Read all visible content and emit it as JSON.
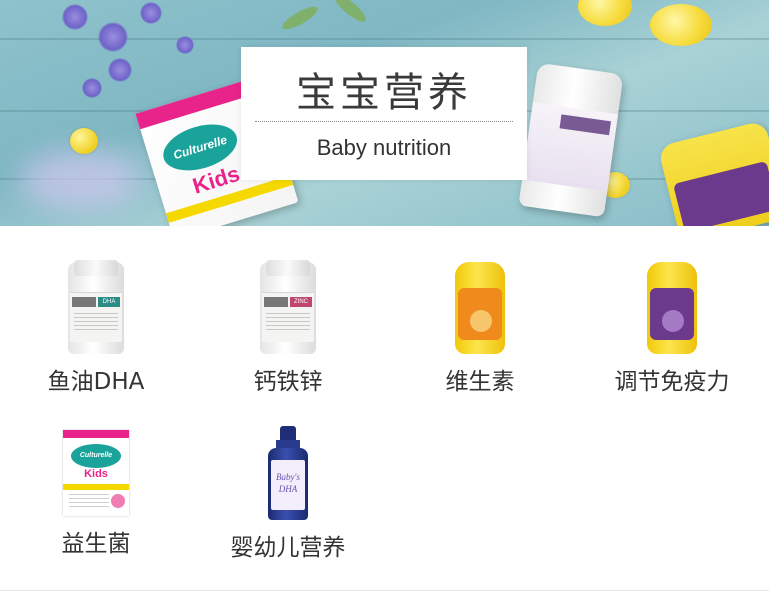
{
  "banner": {
    "title_cn": "宝宝营养",
    "title_en": "Baby nutrition"
  },
  "categories": [
    {
      "label": "鱼油DHA",
      "product": "bottle",
      "tag": "DHA",
      "tag_color": "#2c8c86"
    },
    {
      "label": "钙铁锌",
      "product": "bottle",
      "tag": "ZINC",
      "tag_color": "#c0466e"
    },
    {
      "label": "维生素",
      "product": "jar",
      "jar_label_color": "#f08a1c"
    },
    {
      "label": "调节免疫力",
      "product": "jar",
      "jar_label_color": "#6b3a8c"
    },
    {
      "label": "益生菌",
      "product": "box"
    },
    {
      "label": "婴幼儿营养",
      "product": "dropper"
    }
  ],
  "colors": {
    "banner_base": "#8fc3cc",
    "label_text": "#333333",
    "background": "#ffffff"
  }
}
